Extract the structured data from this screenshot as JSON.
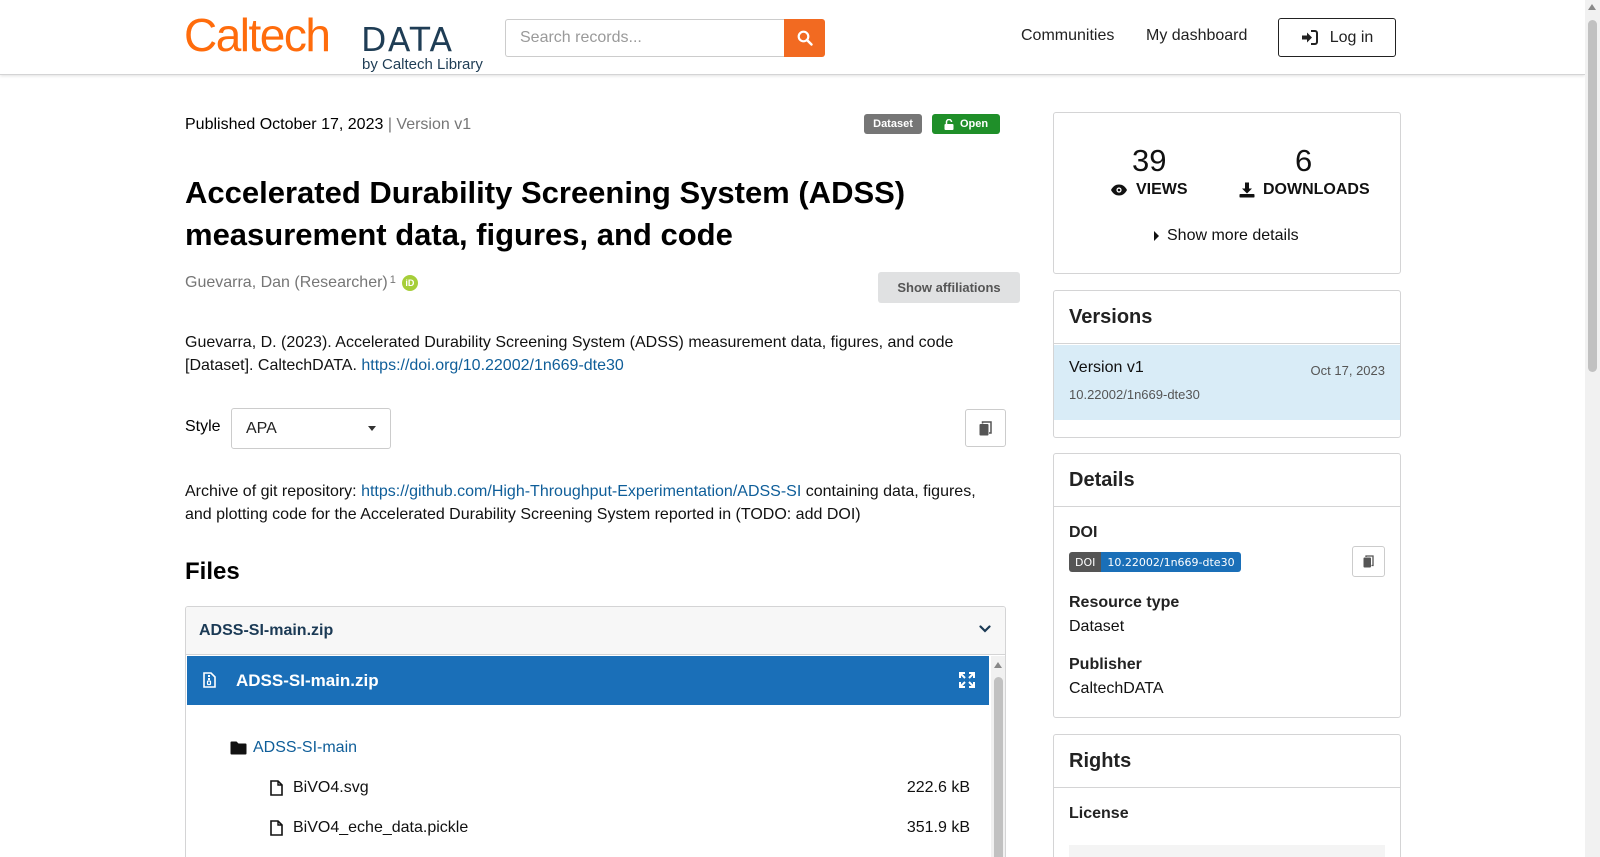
{
  "header": {
    "logo_main": "Caltech",
    "logo_data": "DATA",
    "logo_by": "by Caltech Library",
    "search_placeholder": "Search records...",
    "nav": [
      "Communities",
      "My dashboard"
    ],
    "login_label": "Log in"
  },
  "record": {
    "published": "Published October 17, 2023",
    "version": "| Version v1",
    "badge_type": "Dataset",
    "badge_access": "Open",
    "title": "Accelerated Durability Screening System (ADSS) measurement data, figures, and code",
    "author": "Guevarra, Dan (Researcher)",
    "author_sup": "1",
    "orcid_icon_text": "iD",
    "show_affiliations": "Show affiliations",
    "citation_text": "Guevarra, D. (2023). Accelerated Durability Screening System (ADSS) measurement data, figures, and code [Dataset]. CaltechDATA.",
    "citation_link": "https://doi.org/10.22002/1n669-dte30",
    "style_label": "Style",
    "style_value": "APA",
    "description_before": "Archive of git repository:",
    "description_link": "https://github.com/High-Throughput-Experimentation/ADSS-SI",
    "description_after": "containing data, figures, and plotting code for the Accelerated Durability Screening System reported in (TODO: add DOI)"
  },
  "files": {
    "heading": "Files",
    "archive_name": "ADSS-SI-main.zip",
    "preview_name": "ADSS-SI-main.zip",
    "folder": "ADSS-SI-main",
    "items": [
      {
        "name": "BiVO4.svg",
        "size": "222.6 kB"
      },
      {
        "name": "BiVO4_eche_data.pickle",
        "size": "351.9 kB"
      }
    ]
  },
  "stats": {
    "views": "39",
    "views_label": "VIEWS",
    "downloads": "6",
    "downloads_label": "DOWNLOADS",
    "more_details": "Show more details"
  },
  "versions": {
    "heading": "Versions",
    "current_name": "Version v1",
    "current_date": "Oct 17, 2023",
    "current_doi": "10.22002/1n669-dte30"
  },
  "details": {
    "heading": "Details",
    "doi_label": "DOI",
    "doi_badge_left": "DOI",
    "doi_badge_right": "10.22002/1n669-dte30",
    "resource_type_label": "Resource type",
    "resource_type_value": "Dataset",
    "publisher_label": "Publisher",
    "publisher_value": "CaltechDATA"
  },
  "rights": {
    "heading": "Rights",
    "license_label": "License"
  },
  "colors": {
    "brand_orange": "#ff6c0c",
    "link_blue": "#0f5e99",
    "preview_blue": "#1a6fb8",
    "open_green": "#1f8f29"
  }
}
